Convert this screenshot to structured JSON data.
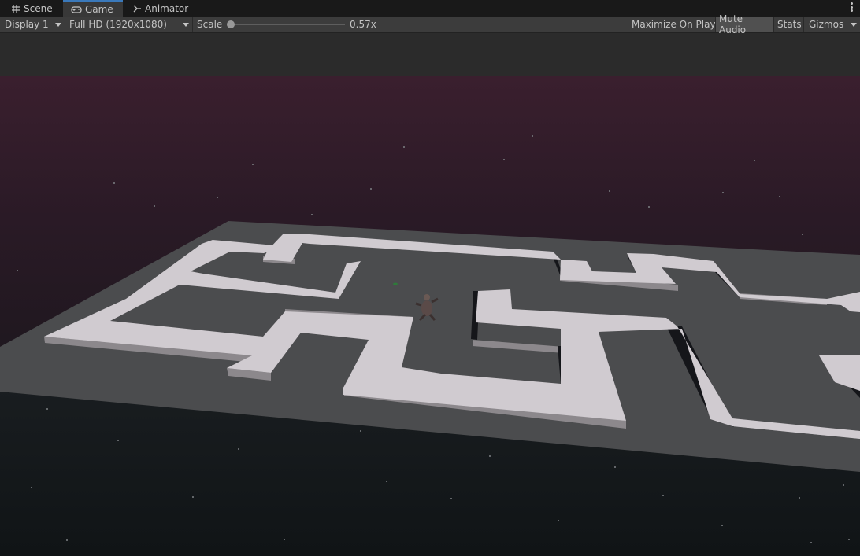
{
  "tabs": [
    {
      "label": "Scene",
      "icon": "grid-icon"
    },
    {
      "label": "Game",
      "icon": "gamepad-icon"
    },
    {
      "label": "Animator",
      "icon": "animator-icon"
    }
  ],
  "toolbar": {
    "display": "Display 1",
    "resolution": "Full HD (1920x1080)",
    "scale_label": "Scale",
    "scale_value": "0.57x",
    "scale_fraction": 0.0,
    "maximize_on_play": "Maximize On Play",
    "mute_audio": "Mute Audio",
    "stats": "Stats",
    "gizmos": "Gizmos"
  },
  "colors": {
    "accent": "#3a79bb",
    "sky_top": "#3a1f2e",
    "ground": "#4a4b4d",
    "wall_top": "#cdc8cc"
  }
}
